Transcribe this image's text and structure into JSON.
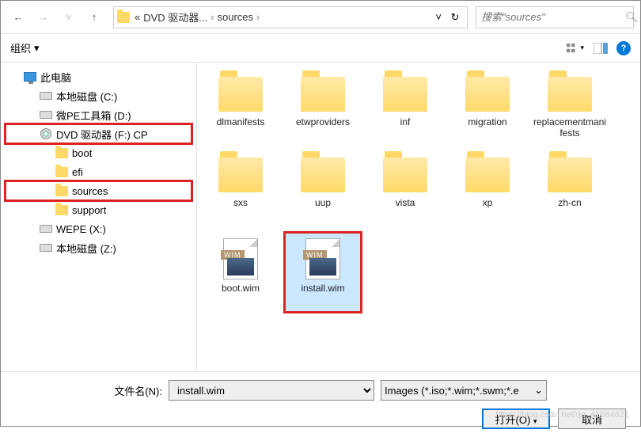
{
  "nav": {
    "breadcrumb": [
      "DVD 驱动器...",
      "sources"
    ],
    "search_placeholder": "搜索\"sources\""
  },
  "toolbar": {
    "organize": "组织",
    "help": "?"
  },
  "sidebar": {
    "items": [
      {
        "label": "此电脑",
        "icon": "monitor",
        "indent": 1
      },
      {
        "label": "本地磁盘 (C:)",
        "icon": "drive",
        "indent": 2
      },
      {
        "label": "微PE工具箱 (D:)",
        "icon": "drive",
        "indent": 2
      },
      {
        "label": "DVD 驱动器 (F:) CP",
        "icon": "dvd",
        "indent": 2,
        "highlight": true
      },
      {
        "label": "boot",
        "icon": "folder",
        "indent": 3
      },
      {
        "label": "efi",
        "icon": "folder",
        "indent": 3
      },
      {
        "label": "sources",
        "icon": "folder",
        "indent": 3,
        "highlight": true
      },
      {
        "label": "support",
        "icon": "folder",
        "indent": 3
      },
      {
        "label": "WEPE (X:)",
        "icon": "drive",
        "indent": 2
      },
      {
        "label": "本地磁盘 (Z:)",
        "icon": "drive",
        "indent": 2
      }
    ]
  },
  "files": [
    {
      "name": "dlmanifests",
      "type": "folder"
    },
    {
      "name": "etwproviders",
      "type": "folder"
    },
    {
      "name": "inf",
      "type": "folder"
    },
    {
      "name": "migration",
      "type": "folder"
    },
    {
      "name": "replacementmanifests",
      "type": "folder"
    },
    {
      "name": "sxs",
      "type": "folder"
    },
    {
      "name": "uup",
      "type": "folder"
    },
    {
      "name": "vista",
      "type": "folder"
    },
    {
      "name": "xp",
      "type": "folder"
    },
    {
      "name": "zh-cn",
      "type": "folder"
    },
    {
      "name": "boot.wim",
      "type": "wim",
      "tag": "WIM"
    },
    {
      "name": "install.wim",
      "type": "wim",
      "tag": "WIM",
      "selected": true,
      "highlight": true
    }
  ],
  "bottom": {
    "filename_label": "文件名(N):",
    "filename_value": "install.wim",
    "filter": "Images (*.iso;*.wim;*.swm;*.e",
    "open": "打开(O)",
    "cancel": "取消"
  },
  "watermark": "https://blog.csdn.net/qq_41684621"
}
